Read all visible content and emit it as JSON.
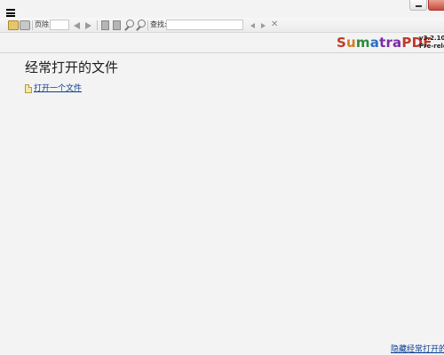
{
  "toolbar": {
    "page_label": "页除",
    "find_label": "查找:"
  },
  "brand": {
    "name_parts": [
      "S",
      "u",
      "m",
      "a",
      "tra",
      "PDF"
    ],
    "version": "v3.2.107",
    "prerelease": "Pre-rele"
  },
  "content": {
    "heading": "经常打开的文件",
    "open_link": "打开一个文件",
    "hide_link": "隐藏经常打开的"
  },
  "colors": {
    "link": "#0b3d91",
    "brand_red": "#c03a2b",
    "close_button": "#c74b3b"
  }
}
